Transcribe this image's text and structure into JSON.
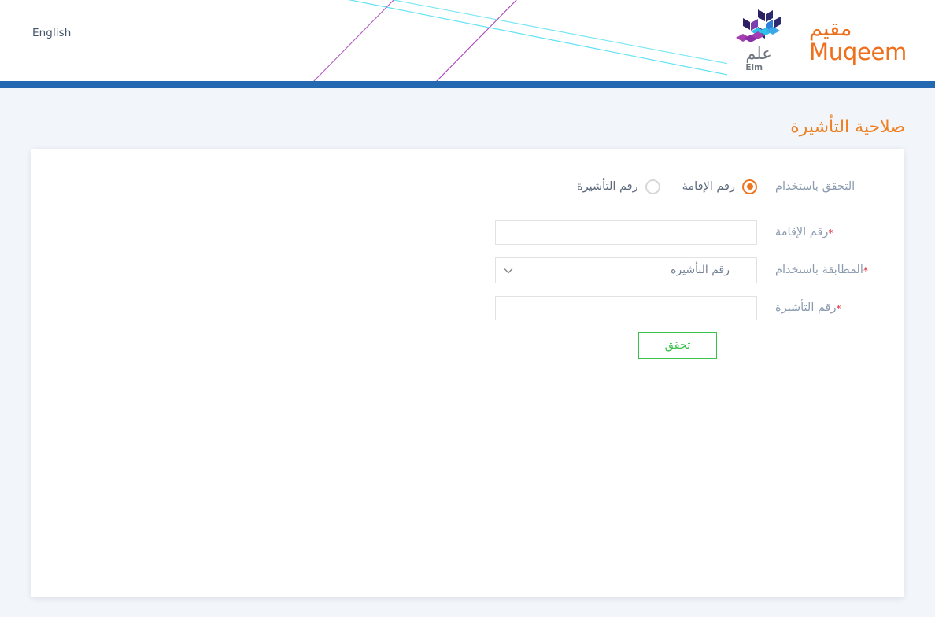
{
  "header": {
    "language_link": "English",
    "brand": {
      "muqeem_ar": "مقيم",
      "muqeem_en": "Muqeem",
      "elm_ar": "علم",
      "elm_en": "Elm"
    },
    "colors": {
      "muqeem_orange": "#ee6f1c",
      "elm_gray": "#6e7680",
      "blue_bar": "#2468b2",
      "deco_cyan": "#55e0f0",
      "deco_purple": "#a855b5"
    }
  },
  "page": {
    "title": "صلاحية التأشيرة",
    "title_color": "#ee8022",
    "background": "#f2f5fa"
  },
  "form": {
    "method_label": "التحقق باستخدام",
    "radio_options": [
      {
        "label": "رقم الإقامة",
        "selected": true
      },
      {
        "label": "رقم التأشيرة",
        "selected": false
      }
    ],
    "fields": [
      {
        "label": "رقم الإقامة",
        "required": true,
        "type": "text",
        "value": "",
        "placeholder": ""
      },
      {
        "label": "المطابقة باستخدام",
        "required": true,
        "type": "select",
        "value": "رقم التأشيرة",
        "options": [
          "رقم التأشيرة"
        ]
      },
      {
        "label": "رقم التأشيرة",
        "required": true,
        "type": "text",
        "value": "",
        "placeholder": ""
      }
    ],
    "required_marker": "*",
    "submit_label": "تحقق",
    "submit_color": "#3ac14a",
    "label_color": "#8b9bb0",
    "radio_accent": "#ef7620"
  },
  "icons": {
    "chevron_down": "chevron-down-icon"
  }
}
